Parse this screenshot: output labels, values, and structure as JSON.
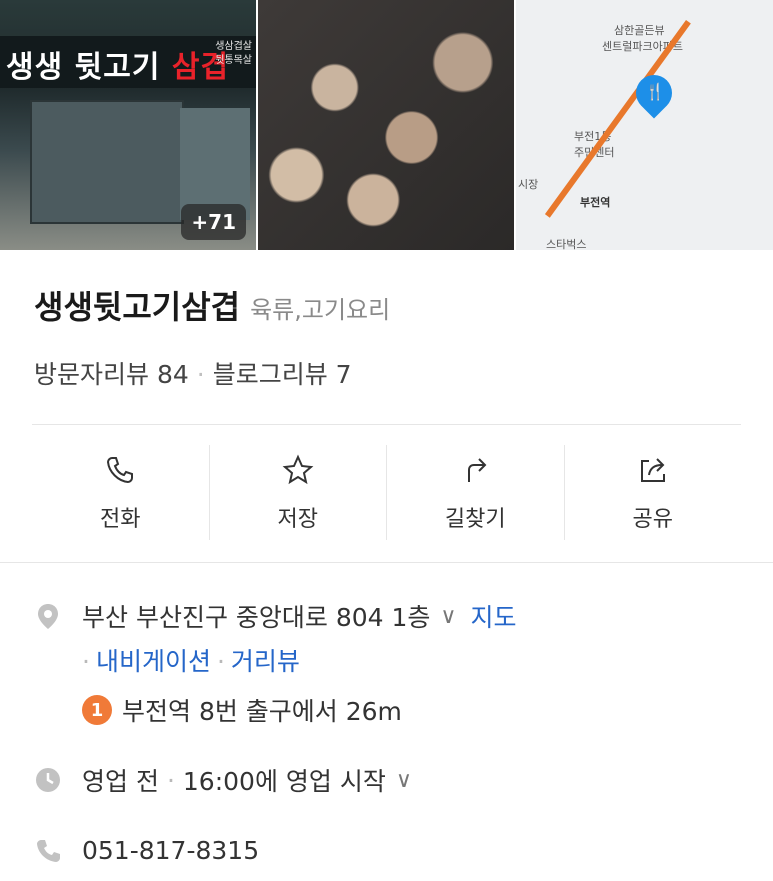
{
  "photos": {
    "sign_prefix": "생생",
    "sign_main": "뒷고기",
    "sign_accent": "삼겹",
    "sign_sub": [
      "생삼겹살",
      "뒷통목살"
    ],
    "count": "+71",
    "map_labels": [
      "삼한골든뷰",
      "센트럴파크아파트",
      "부전1동",
      "주민센터",
      "부전역",
      "시장",
      "스타벅스"
    ]
  },
  "place": {
    "title": "생생뒷고기삼겹",
    "category": "육류,고기요리"
  },
  "reviews": {
    "visitor": "방문자리뷰 84",
    "blog": "블로그리뷰 7"
  },
  "actions": [
    {
      "label": "전화",
      "icon": "phone-icon"
    },
    {
      "label": "저장",
      "icon": "star-icon"
    },
    {
      "label": "길찾기",
      "icon": "directions-icon"
    },
    {
      "label": "공유",
      "icon": "share-icon"
    }
  ],
  "address": {
    "text": "부산 부산진구 중앙대로 804 1층",
    "map_link": "지도",
    "navi_link": "내비게이션",
    "street_link": "거리뷰",
    "subway_badge": "1",
    "subway_text": "부전역 8번 출구에서 26m"
  },
  "hours": {
    "text": "영업 전",
    "detail": "16:00에 영업 시작"
  },
  "phone": {
    "number": "051-817-8315"
  },
  "colors": {
    "link": "#2566c9",
    "subway": "#f07a38",
    "pin": "#1d8fe8"
  }
}
